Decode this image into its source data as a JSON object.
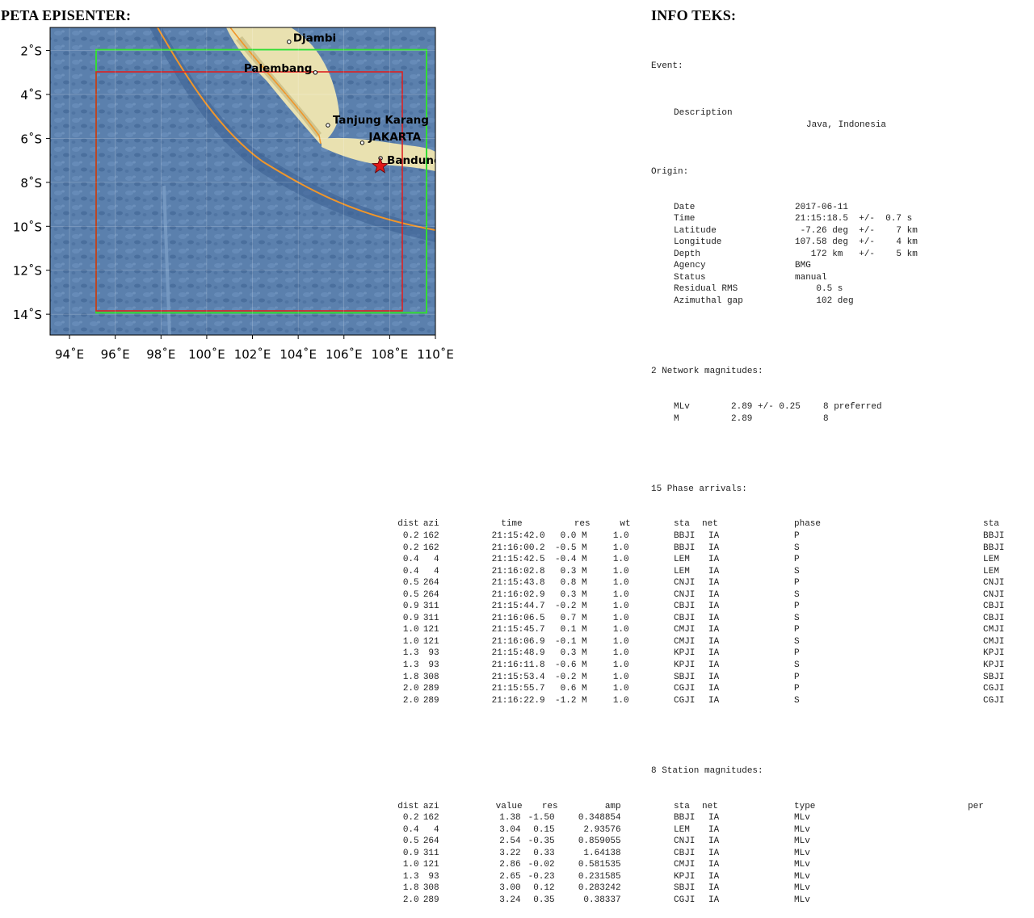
{
  "map": {
    "title": "PETA EPISENTER:",
    "lat_ticks": [
      {
        "lat": -2,
        "label": "2˚S"
      },
      {
        "lat": -4,
        "label": "4˚S"
      },
      {
        "lat": -6,
        "label": "6˚S"
      },
      {
        "lat": -8,
        "label": "8˚S"
      },
      {
        "lat": -10,
        "label": "10˚S"
      },
      {
        "lat": -12,
        "label": "12˚S"
      },
      {
        "lat": -14,
        "label": "14˚S"
      }
    ],
    "lon_ticks": [
      {
        "lon": 94,
        "label": "94˚E"
      },
      {
        "lon": 96,
        "label": "96˚E"
      },
      {
        "lon": 98,
        "label": "98˚E"
      },
      {
        "lon": 100,
        "label": "100˚E"
      },
      {
        "lon": 102,
        "label": "102˚E"
      },
      {
        "lon": 104,
        "label": "104˚E"
      },
      {
        "lon": 106,
        "label": "106˚E"
      },
      {
        "lon": 108,
        "label": "108˚E"
      },
      {
        "lon": 110,
        "label": "110˚E"
      }
    ],
    "cities": [
      {
        "name": "Djambi",
        "lat": -1.6,
        "lon": 103.6
      },
      {
        "name": "Palembang",
        "lat": -3.0,
        "lon": 104.75
      },
      {
        "name": "Tanjung Karang",
        "lat": -5.4,
        "lon": 105.3
      },
      {
        "name": "JAKARTA",
        "lat": -6.2,
        "lon": 106.8
      },
      {
        "name": "Bandung",
        "lat": -6.9,
        "lon": 107.6
      }
    ],
    "epicenter": {
      "lat": -7.26,
      "lon": 107.58
    },
    "colors": {
      "sea": "#5477a6",
      "land": "#e9e1b0",
      "fault": "#f0962a",
      "green_box": "#33dd33",
      "red_box": "#dd2222",
      "star": "#e01818"
    }
  },
  "info": {
    "title": "INFO TEKS:",
    "event_label": "Event:",
    "description_label": "Description",
    "description": "Java, Indonesia",
    "origin_label": "Origin:",
    "origin": [
      {
        "label": "Date",
        "value": "2017-06-11"
      },
      {
        "label": "Time",
        "value": "21:15:18.5  +/-  0.7 s"
      },
      {
        "label": "Latitude",
        "value": " -7.26 deg  +/-    7 km"
      },
      {
        "label": "Longitude",
        "value": "107.58 deg  +/-    4 km"
      },
      {
        "label": "Depth",
        "value": "   172 km   +/-    5 km"
      },
      {
        "label": "Agency",
        "value": "BMG"
      },
      {
        "label": "Status",
        "value": "manual"
      },
      {
        "label": "Residual RMS",
        "value": "    0.5 s"
      },
      {
        "label": "Azimuthal gap",
        "value": "    102 deg"
      }
    ],
    "netmag_label": "2 Network magnitudes:",
    "netmags": [
      {
        "type": "MLv",
        "value": "2.89 +/- 0.25",
        "count": "8 preferred"
      },
      {
        "type": "M",
        "value": "2.89",
        "count": "8"
      }
    ],
    "phase_label": "15 Phase arrivals:",
    "phase_headers": [
      "sta",
      "net",
      "dist",
      "azi",
      "phase",
      "time",
      "res",
      "wt",
      "sta"
    ],
    "phases": [
      [
        "BBJI",
        "IA",
        "0.2",
        "162",
        "P",
        "21:15:42.0",
        "0.0 M",
        "1.0",
        "BBJI"
      ],
      [
        "BBJI",
        "IA",
        "0.2",
        "162",
        "S",
        "21:16:00.2",
        "-0.5 M",
        "1.0",
        "BBJI"
      ],
      [
        "LEM",
        "IA",
        "0.4",
        "4",
        "P",
        "21:15:42.5",
        "-0.4 M",
        "1.0",
        "LEM"
      ],
      [
        "LEM",
        "IA",
        "0.4",
        "4",
        "S",
        "21:16:02.8",
        "0.3 M",
        "1.0",
        "LEM"
      ],
      [
        "CNJI",
        "IA",
        "0.5",
        "264",
        "P",
        "21:15:43.8",
        "0.8 M",
        "1.0",
        "CNJI"
      ],
      [
        "CNJI",
        "IA",
        "0.5",
        "264",
        "S",
        "21:16:02.9",
        "0.3 M",
        "1.0",
        "CNJI"
      ],
      [
        "CBJI",
        "IA",
        "0.9",
        "311",
        "P",
        "21:15:44.7",
        "-0.2 M",
        "1.0",
        "CBJI"
      ],
      [
        "CBJI",
        "IA",
        "0.9",
        "311",
        "S",
        "21:16:06.5",
        "0.7 M",
        "1.0",
        "CBJI"
      ],
      [
        "CMJI",
        "IA",
        "1.0",
        "121",
        "P",
        "21:15:45.7",
        "0.1 M",
        "1.0",
        "CMJI"
      ],
      [
        "CMJI",
        "IA",
        "1.0",
        "121",
        "S",
        "21:16:06.9",
        "-0.1 M",
        "1.0",
        "CMJI"
      ],
      [
        "KPJI",
        "IA",
        "1.3",
        "93",
        "P",
        "21:15:48.9",
        "0.3 M",
        "1.0",
        "KPJI"
      ],
      [
        "KPJI",
        "IA",
        "1.3",
        "93",
        "S",
        "21:16:11.8",
        "-0.6 M",
        "1.0",
        "KPJI"
      ],
      [
        "SBJI",
        "IA",
        "1.8",
        "308",
        "P",
        "21:15:53.4",
        "-0.2 M",
        "1.0",
        "SBJI"
      ],
      [
        "CGJI",
        "IA",
        "2.0",
        "289",
        "P",
        "21:15:55.7",
        "0.6 M",
        "1.0",
        "CGJI"
      ],
      [
        "CGJI",
        "IA",
        "2.0",
        "289",
        "S",
        "21:16:22.9",
        "-1.2 M",
        "1.0",
        "CGJI"
      ]
    ],
    "stamag_label": "8 Station magnitudes:",
    "stamag_headers": [
      "sta",
      "net",
      "dist",
      "azi",
      "type",
      "value",
      "res",
      "amp",
      "per"
    ],
    "stamags": [
      [
        "BBJI",
        "IA",
        "0.2",
        "162",
        "MLv",
        "1.38",
        "-1.50",
        "0.348854"
      ],
      [
        "LEM",
        "IA",
        "0.4",
        "4",
        "MLv",
        "3.04",
        "0.15",
        "2.93576"
      ],
      [
        "CNJI",
        "IA",
        "0.5",
        "264",
        "MLv",
        "2.54",
        "-0.35",
        "0.859055"
      ],
      [
        "CBJI",
        "IA",
        "0.9",
        "311",
        "MLv",
        "3.22",
        "0.33",
        "1.64138"
      ],
      [
        "CMJI",
        "IA",
        "1.0",
        "121",
        "MLv",
        "2.86",
        "-0.02",
        "0.581535"
      ],
      [
        "KPJI",
        "IA",
        "1.3",
        "93",
        "MLv",
        "2.65",
        "-0.23",
        "0.231585"
      ],
      [
        "SBJI",
        "IA",
        "1.8",
        "308",
        "MLv",
        "3.00",
        "0.12",
        "0.283242"
      ],
      [
        "CGJI",
        "IA",
        "2.0",
        "289",
        "MLv",
        "3.24",
        "0.35",
        "0.38337"
      ]
    ]
  }
}
